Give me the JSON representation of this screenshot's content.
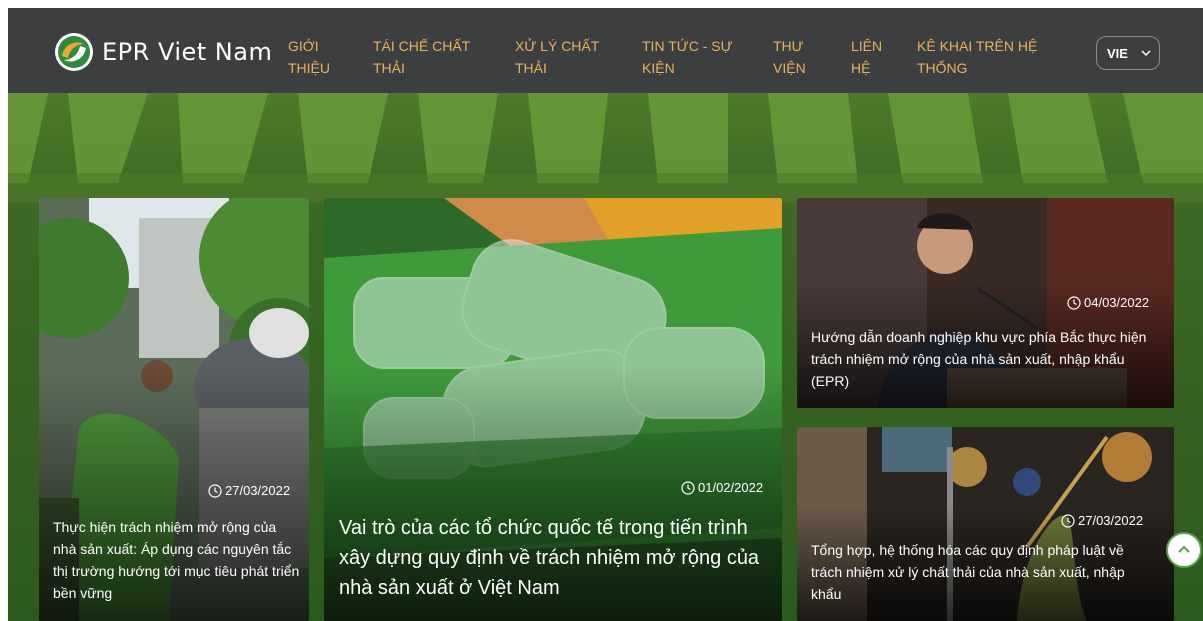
{
  "brand": {
    "name": "EPR Viet Nam",
    "colors": {
      "nav_bg": "#3d3e40",
      "nav_text": "#e8b25a",
      "accent_green": "#5aa04a",
      "logo_orange": "#f2a533"
    }
  },
  "nav": {
    "items": [
      {
        "label": "GIỚI THIỆU"
      },
      {
        "label": "TÁI CHẾ CHẤT THẢI"
      },
      {
        "label": "XỬ LÝ CHẤT THẢI"
      },
      {
        "label": "TIN TỨC - SỰ KIỆN"
      },
      {
        "label": "THƯ VIỆN"
      },
      {
        "label": "LIÊN HỆ"
      },
      {
        "label": "KÊ KHAI TRÊN HỆ THỐNG"
      }
    ],
    "language": {
      "selected": "VIE"
    }
  },
  "articles": {
    "left": {
      "date": "27/03/2022",
      "title": "Thực hiện trách nhiệm mở rộng của nhà sản xuất: Áp dụng các nguyên tắc thị trường hướng tới mục tiêu phát triển bền vững"
    },
    "center": {
      "date": "01/02/2022",
      "title": "Vai trò của các tổ chức quốc tế trong tiến trình xây dựng quy định về trách nhiệm mở rộng của nhà sản xuất ở Việt Nam"
    },
    "right_top": {
      "date": "04/03/2022",
      "title": "Hướng dẫn doanh nghiệp khu vực phía Bắc thực hiện trách nhiệm mở rộng của nhà sản xuất, nhập khẩu (EPR)"
    },
    "right_bottom": {
      "date": "27/03/2022",
      "title": "Tổng hợp, hệ thống hóa các quy định pháp luật về trách nhiệm xử lý chất thải của nhà sản xuất, nhập khẩu"
    }
  },
  "icons": {
    "logo": "recycle-leaf-icon",
    "clock": "clock-icon",
    "chevron": "chevron-down-icon",
    "scroll_top": "chevron-up-icon"
  }
}
